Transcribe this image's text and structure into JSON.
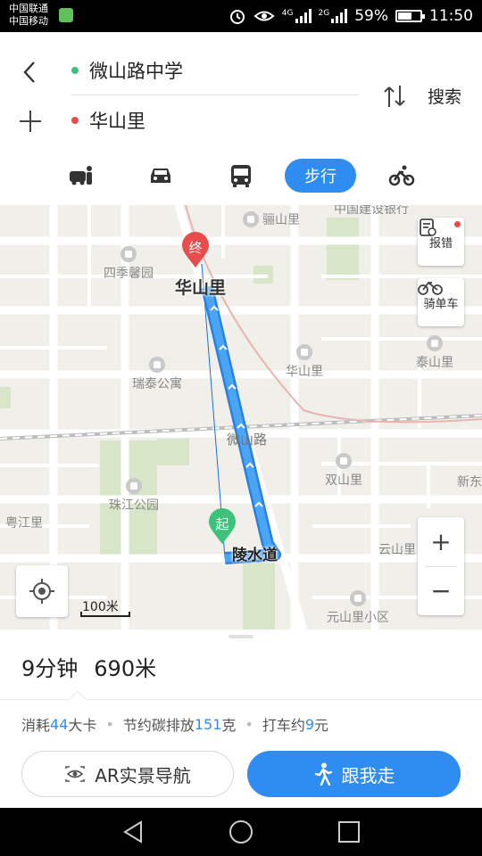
{
  "status_bar": {
    "carrier_1": "中国联通",
    "carrier_2": "中国移动",
    "net_1": "4G",
    "net_2": "2G",
    "battery": "59%",
    "time": "11:50"
  },
  "route": {
    "origin": "微山路中学",
    "destination": "华山里",
    "search_label": "搜索",
    "origin_color": "#3cc27a",
    "destination_color": "#e84c4c"
  },
  "modes": {
    "active_label": "步行",
    "items": [
      "taxi-icon",
      "car-icon",
      "bus-icon",
      "walk",
      "bike-icon"
    ]
  },
  "map": {
    "pois": {
      "lishanli": "骊山里",
      "bank": "中国建设银行",
      "sijixinyuan": "四季馨园",
      "huashanli_poi": "华山里",
      "taishanli": "泰山里",
      "ruitai": "瑞泰公寓",
      "shuangshanli": "双山里",
      "xindong": "新东",
      "zhujiang": "珠江公园",
      "yuejiang": "粤江里",
      "yunshanli": "云山里",
      "yuanshanli": "元山里小区"
    },
    "roads": {
      "weishan_road": "微山路",
      "lingshui_road": "陵水道"
    },
    "end_marker": "终",
    "start_marker": "起",
    "destination_label": "华山里",
    "report_label": "报错",
    "bike_label": "骑单车",
    "scale": "100米",
    "accent": "#2f8cf0"
  },
  "summary": {
    "duration": "9分钟",
    "distance": "690米",
    "calorie_prefix": "消耗",
    "calorie_value": "44",
    "calorie_unit": "大卡",
    "carbon_prefix": "节约碳排放",
    "carbon_value": "151",
    "carbon_unit": "克",
    "taxi_prefix": "打车约",
    "taxi_value": "9",
    "taxi_unit": "元",
    "ar_label": "AR实景导航",
    "follow_label": "跟我走"
  }
}
